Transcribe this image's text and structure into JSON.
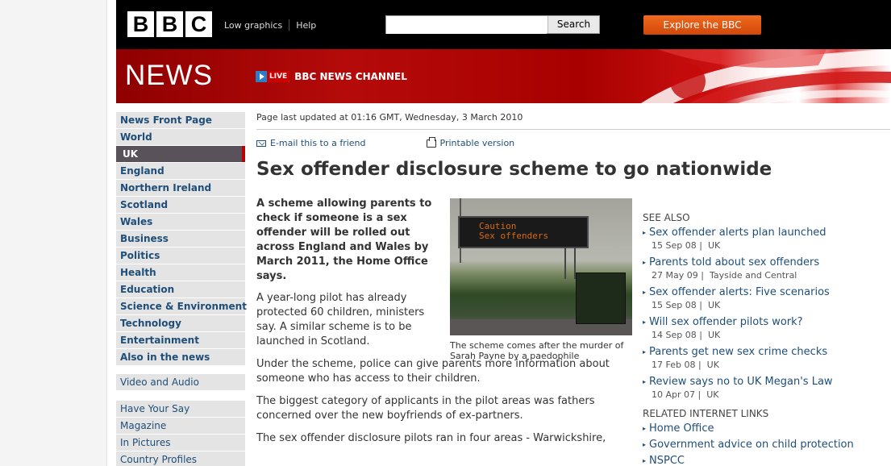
{
  "header": {
    "logo_letters": [
      "B",
      "B",
      "C"
    ],
    "low_graphics": "Low graphics",
    "help": "Help",
    "search_placeholder": "",
    "search_button": "Search",
    "explore_button": "Explore the BBC"
  },
  "banner": {
    "title": "NEWS",
    "live_tag": "LIVE",
    "channel": "BBC NEWS CHANNEL"
  },
  "nav": {
    "items": [
      {
        "label": "News Front Page"
      },
      {
        "label": "World"
      },
      {
        "label": "UK",
        "active": true
      },
      {
        "label": "England"
      },
      {
        "label": "Northern Ireland"
      },
      {
        "label": "Scotland"
      },
      {
        "label": "Wales"
      },
      {
        "label": "Business"
      },
      {
        "label": "Politics"
      },
      {
        "label": "Health"
      },
      {
        "label": "Education"
      },
      {
        "label": "Science & Environment"
      },
      {
        "label": "Technology"
      },
      {
        "label": "Entertainment"
      },
      {
        "label": "Also in the news"
      }
    ],
    "video_audio": "Video and Audio",
    "secondary": [
      "Have Your Say",
      "Magazine",
      "In Pictures",
      "Country Profiles"
    ]
  },
  "article": {
    "updated": "Page last updated at 01:16 GMT, Wednesday, 3 March 2010",
    "email_link": "E-mail this to a friend",
    "print_link": "Printable version",
    "headline": "Sex offender disclosure scheme to go nationwide",
    "intro": "A scheme allowing parents to check if someone is a sex offender will be rolled out across England and Wales by March 2011, the Home Office says.",
    "para1": "A year-long pilot has already protected 60 children, ministers say. A similar scheme is to be launched in Scotland.",
    "para2": "Under the scheme, police can give parents more information about someone who has access to their children.",
    "para3": "The biggest category of applicants in the pilot areas was fathers concerned over the new boyfriends of ex-partners.",
    "para4": "The sex offender disclosure pilots ran in four areas - Warwickshire,",
    "photo_sign_line1": "Caution",
    "photo_sign_line2": "Sex offenders",
    "caption": "The scheme comes after the murder of Sarah Payne by a paedophile"
  },
  "see_also": {
    "heading": "SEE ALSO",
    "links": [
      {
        "title": "Sex offender alerts plan launched",
        "date": "15 Sep 08",
        "section": "UK"
      },
      {
        "title": "Parents told about sex offenders",
        "date": "27 May 09",
        "section": "Tayside and Central"
      },
      {
        "title": "Sex offender alerts: Five scenarios",
        "date": "15 Sep 08",
        "section": "UK"
      },
      {
        "title": "Will sex offender pilots work?",
        "date": "14 Sep 08",
        "section": "UK"
      },
      {
        "title": "Parents get new sex crime checks",
        "date": "17 Feb 08",
        "section": "UK"
      },
      {
        "title": "Review says no to UK Megan's Law",
        "date": "10 Apr 07",
        "section": "UK"
      }
    ]
  },
  "related": {
    "heading": "RELATED INTERNET LINKS",
    "links": [
      "Home Office",
      "Government advice on child protection",
      "NSPCC"
    ]
  },
  "colors": {
    "link_blue": "#1f4e79",
    "news_red": "#b00000",
    "explore_orange": "#e2571a"
  }
}
